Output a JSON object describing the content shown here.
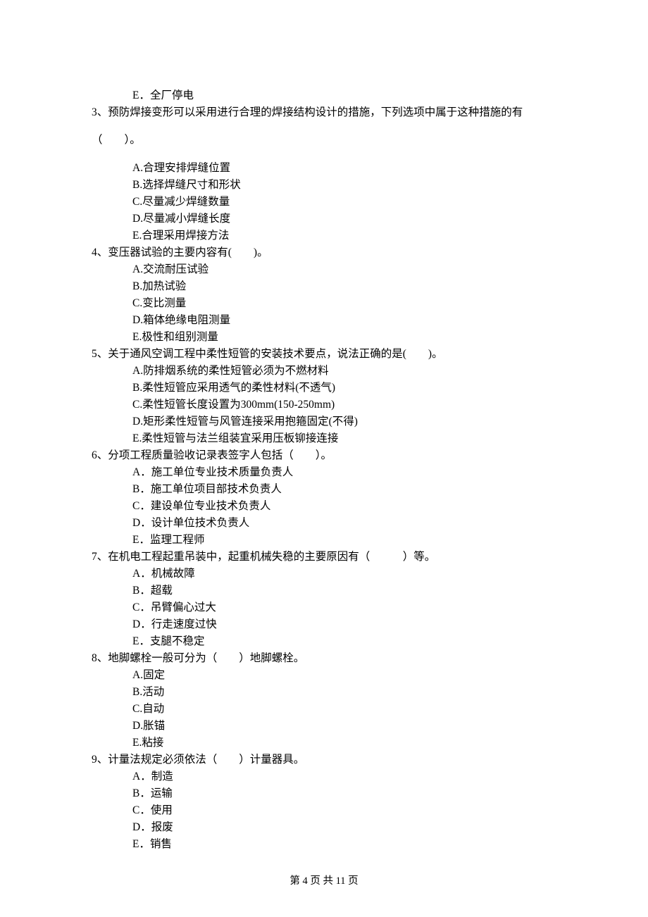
{
  "orphan_option": "E．全厂停电",
  "questions": [
    {
      "num": "3、",
      "stem_line1": "预防焊接变形可以采用进行合理的焊接结构设计的措施，下列选项中属于这种措施的有",
      "stem_line2": "（　　）。",
      "options": [
        "A.合理安排焊缝位置",
        "B.选择焊缝尺寸和形状",
        "C.尽量减少焊缝数量",
        "D.尽量减小焊缝长度",
        "E.合理采用焊接方法"
      ]
    },
    {
      "num": "4、",
      "stem_line1": "变压器试验的主要内容有(　　)。",
      "options": [
        "A.交流耐压试验",
        "B.加热试验",
        "C.变比测量",
        "D.箱体绝缘电阻测量",
        "E.极性和组别测量"
      ]
    },
    {
      "num": "5、",
      "stem_line1": "关于通风空调工程中柔性短管的安装技术要点，说法正确的是(　　)。",
      "options": [
        "A.防排烟系统的柔性短管必须为不燃材料",
        "B.柔性短管应采用透气的柔性材料(不透气)",
        "C.柔性短管长度设置为300mm(150-250mm)",
        "D.矩形柔性短管与风管连接采用抱箍固定(不得)",
        "E.柔性短管与法兰组装宜采用压板铆接连接"
      ]
    },
    {
      "num": "6、",
      "stem_line1": "分项工程质量验收记录表签字人包括（　　）。",
      "options": [
        "A．施工单位专业技术质量负责人",
        "B．施工单位项目部技术负责人",
        "C．建设单位专业技术负责人",
        "D．设计单位技术负责人",
        "E．监理工程师"
      ]
    },
    {
      "num": "7、",
      "stem_line1": "在机电工程起重吊装中，起重机械失稳的主要原因有（　　　）等。",
      "options": [
        "A．机械故障",
        "B．超载",
        "C．吊臂偏心过大",
        "D．行走速度过快",
        "E．支腿不稳定"
      ]
    },
    {
      "num": "8、",
      "stem_line1": "地脚螺栓一般可分为（　　）地脚螺栓。",
      "options": [
        "A.固定",
        "B.活动",
        "C.自动",
        "D.胀锚",
        "E.粘接"
      ]
    },
    {
      "num": "9、",
      "stem_line1": "计量法规定必须依法（　　）计量器具。",
      "options": [
        "A．制造",
        "B．运输",
        "C．使用",
        "D．报废",
        "E．销售"
      ]
    }
  ],
  "footer": "第 4 页 共 11 页"
}
